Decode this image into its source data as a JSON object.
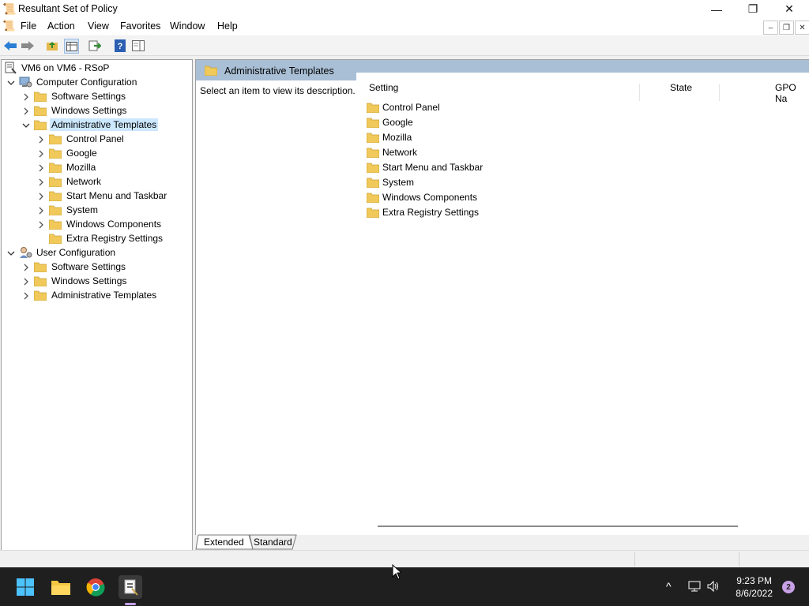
{
  "window": {
    "title": "Resultant Set of Policy",
    "minimize_glyph": "—",
    "maximize_glyph": "❐",
    "close_glyph": "✕"
  },
  "menu": {
    "items": [
      "File",
      "Action",
      "View",
      "Favorites",
      "Window",
      "Help"
    ]
  },
  "tree": {
    "root": "VM6 on VM6 - RSoP",
    "computer": {
      "label": "Computer Configuration",
      "software": "Software Settings",
      "windows": "Windows Settings",
      "admin": "Administrative Templates",
      "admin_children": [
        "Control Panel",
        "Google",
        "Mozilla",
        "Network",
        "Start Menu and Taskbar",
        "System",
        "Windows Components",
        "Extra Registry Settings"
      ]
    },
    "user": {
      "label": "User Configuration",
      "software": "Software Settings",
      "windows": "Windows Settings",
      "admin": "Administrative Templates"
    }
  },
  "rightpane": {
    "header_title": "Administrative Templates",
    "description": "Select an item to view its description.",
    "columns": [
      "Setting",
      "State",
      "GPO Na"
    ],
    "items": [
      "Control Panel",
      "Google",
      "Mozilla",
      "Network",
      "Start Menu and Taskbar",
      "System",
      "Windows Components",
      "Extra Registry Settings"
    ]
  },
  "tabs": [
    "Extended",
    "Standard"
  ],
  "taskbar": {
    "time": "9:23 PM",
    "date": "8/6/2022",
    "notifications": "2"
  },
  "colors": {
    "folder": "#f0c95a",
    "selection": "#cce8ff",
    "header_band": "#a9bfd6",
    "taskbar": "#1f1f1f"
  }
}
